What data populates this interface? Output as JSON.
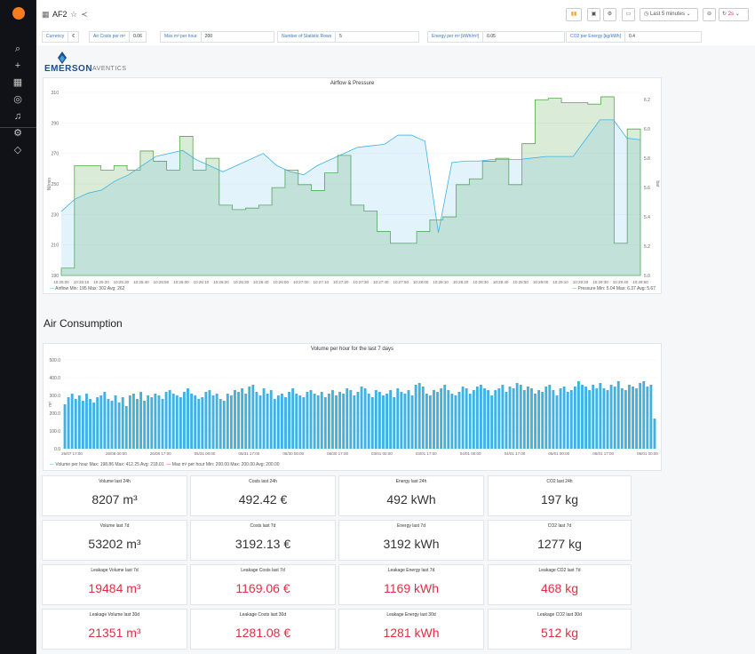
{
  "app": {
    "dashboard_title": "AF2",
    "time_range": "Last 5 minutes",
    "refresh_interval": "2s"
  },
  "variables": [
    {
      "label": "Currency",
      "value": "€"
    },
    {
      "label": "Air Costs per m³",
      "value": "0.06"
    },
    {
      "label": "Max m³ per hour",
      "value": "200"
    },
    {
      "label": "Number of Statistic Rows",
      "value": "5"
    },
    {
      "label": "Energy per m³ [kWh/m³]",
      "value": "0.05"
    },
    {
      "label": "CO2 per Energy [kg/kWh]",
      "value": "0.4"
    }
  ],
  "brand": {
    "name": "EMERSON",
    "sub": "AVENTICS"
  },
  "airflow_panel": {
    "title": "Airflow & Pressure",
    "legend_left": "Airflow  Min: 195  Max: 302  Avg: 262",
    "legend_right": "Pressure  Min: 5.04  Max: 6.37  Avg: 5.67",
    "ylabel_left": "Nl/min",
    "ylabel_right": "bar"
  },
  "section": {
    "title": "Air Consumption"
  },
  "volume_panel": {
    "title": "Volume per hour for the last 7 days",
    "legend": "Volume per hour  Max: 198.86  Max: 412.25  Avg: 218.01",
    "legend2": "Max m³ per hour  Min: 200.00  Max: 200.00  Avg: 200.00",
    "ylabel": "m³"
  },
  "stats": [
    {
      "title": "Volume last 24h",
      "value": "8207 m³",
      "red": false
    },
    {
      "title": "Costs last 24h",
      "value": "492.42 €",
      "red": false
    },
    {
      "title": "Energy last 24h",
      "value": "492 kWh",
      "red": false
    },
    {
      "title": "CO2 last 24h",
      "value": "197 kg",
      "red": false
    },
    {
      "title": "Volume last 7d",
      "value": "53202 m³",
      "red": false
    },
    {
      "title": "Costs last 7d",
      "value": "3192.13 €",
      "red": false
    },
    {
      "title": "Energy last 7d",
      "value": "3192 kWh",
      "red": false
    },
    {
      "title": "CO2 last 7d",
      "value": "1277 kg",
      "red": false
    },
    {
      "title": "Leakage Volume last 7d",
      "value": "19484 m³",
      "red": true
    },
    {
      "title": "Leakage Costs last 7d",
      "value": "1169.06 €",
      "red": true
    },
    {
      "title": "Leakage Energy last 7d",
      "value": "1169 kWh",
      "red": true
    },
    {
      "title": "Leakage CO2 last 7d",
      "value": "468 kg",
      "red": true
    },
    {
      "title": "Leakage Volume last 30d",
      "value": "21351 m³",
      "red": true
    },
    {
      "title": "Leakage Costs last 30d",
      "value": "1281.08 €",
      "red": true
    },
    {
      "title": "Leakage Energy last 30d",
      "value": "1281 kWh",
      "red": true
    },
    {
      "title": "Leakage CO2 last 30d",
      "value": "512 kg",
      "red": true
    }
  ],
  "chart_data": [
    {
      "type": "line",
      "title": "Airflow & Pressure",
      "x": [
        "10:25:00",
        "10:25:10",
        "10:25:20",
        "10:25:30",
        "10:25:40",
        "10:25:50",
        "10:26:00",
        "10:26:10",
        "10:26:20",
        "10:26:30",
        "10:26:40",
        "10:26:50",
        "10:27:00",
        "10:27:10",
        "10:27:20",
        "10:27:30",
        "10:27:40",
        "10:27:50",
        "10:28:00",
        "10:28:10",
        "10:28:20",
        "10:28:30",
        "10:28:40",
        "10:28:50",
        "10:29:00",
        "10:29:10",
        "10:29:20",
        "10:29:30",
        "10:29:40",
        "10:29:50"
      ],
      "y_left_ticks": [
        190,
        210,
        230,
        250,
        270,
        290,
        310
      ],
      "y_right_ticks": [
        5.0,
        5.2,
        5.4,
        5.6,
        5.8,
        6.0,
        6.2
      ],
      "ylim_left": [
        190,
        310
      ],
      "ylim_right": [
        5.0,
        6.25
      ],
      "series": [
        {
          "name": "Airflow",
          "axis": "left",
          "color": "#3fb1e3",
          "values": [
            232,
            240,
            244,
            246,
            252,
            256,
            262,
            268,
            270,
            272,
            266,
            262,
            258,
            262,
            266,
            270,
            262,
            258,
            256,
            262,
            266,
            270,
            274,
            275,
            276,
            282,
            282,
            278,
            218,
            264,
            265,
            265,
            266,
            266,
            266,
            267,
            268,
            268,
            268,
            280,
            292,
            292,
            280,
            279
          ]
        },
        {
          "name": "Pressure",
          "axis": "right",
          "color": "#56a64b",
          "values": [
            5.05,
            5.75,
            5.75,
            5.72,
            5.75,
            5.72,
            5.85,
            5.78,
            5.72,
            5.95,
            5.72,
            5.8,
            5.48,
            5.45,
            5.46,
            5.48,
            5.6,
            5.72,
            5.62,
            5.58,
            5.7,
            5.82,
            5.48,
            5.44,
            5.3,
            5.22,
            5.22,
            5.3,
            5.38,
            5.4,
            5.62,
            5.66,
            5.78,
            5.8,
            5.62,
            5.9,
            6.2,
            6.21,
            6.18,
            6.18,
            6.17,
            6.22,
            5.22,
            6.0
          ]
        }
      ],
      "legend_placement": "bottom"
    },
    {
      "type": "bar",
      "title": "Volume per hour for the last 7 days",
      "ylabel": "m³",
      "y_ticks": [
        0,
        100,
        200,
        300,
        400,
        500
      ],
      "ylim": [
        0,
        500
      ],
      "x_ticks": [
        "26/07 17:00",
        "26/08 00:00",
        "26/08 17:00",
        "05/31 00:00",
        "05/31 17:00",
        "06/30 00:00",
        "06/30 17:00",
        "03/01 00:00",
        "03/01 17:00",
        "04/01 00:00",
        "04/01 17:00",
        "05/01 00:00",
        "05/01 17:00",
        "06/01 00:00"
      ],
      "series": [
        {
          "name": "Volume per hour",
          "color": "#3fb1e3",
          "values": [
            250,
            290,
            310,
            280,
            300,
            270,
            310,
            280,
            260,
            290,
            300,
            320,
            280,
            270,
            300,
            260,
            290,
            240,
            300,
            310,
            280,
            320,
            270,
            300,
            290,
            310,
            300,
            280,
            320,
            330,
            310,
            300,
            290,
            320,
            340,
            310,
            300,
            280,
            290,
            320,
            330,
            300,
            310,
            280,
            270,
            310,
            300,
            330,
            320,
            340,
            310,
            350,
            360,
            320,
            300,
            340,
            310,
            330,
            280,
            300,
            310,
            290,
            320,
            340,
            310,
            300,
            290,
            320,
            330,
            310,
            300,
            320,
            290,
            310,
            330,
            300,
            320,
            310,
            340,
            330,
            300,
            320,
            350,
            340,
            310,
            290,
            330,
            320,
            300,
            310,
            330,
            290,
            340,
            320,
            310,
            330,
            300,
            360,
            370,
            350,
            310,
            300,
            330,
            320,
            340,
            360,
            330,
            310,
            300,
            320,
            350,
            340,
            310,
            330,
            350,
            360,
            340,
            330,
            300,
            330,
            340,
            360,
            320,
            350,
            340,
            370,
            360,
            330,
            350,
            340,
            310,
            330,
            320,
            350,
            360,
            330,
            300,
            340,
            350,
            320,
            330,
            350,
            380,
            360,
            350,
            330,
            360,
            340,
            370,
            340,
            330,
            360,
            350,
            380,
            340,
            330,
            360,
            350,
            340,
            370,
            380,
            350,
            360,
            170
          ]
        },
        {
          "name": "Max m³ per hour",
          "color": "#e02f44",
          "values": [
            200
          ]
        }
      ],
      "legend_placement": "bottom-left"
    }
  ]
}
